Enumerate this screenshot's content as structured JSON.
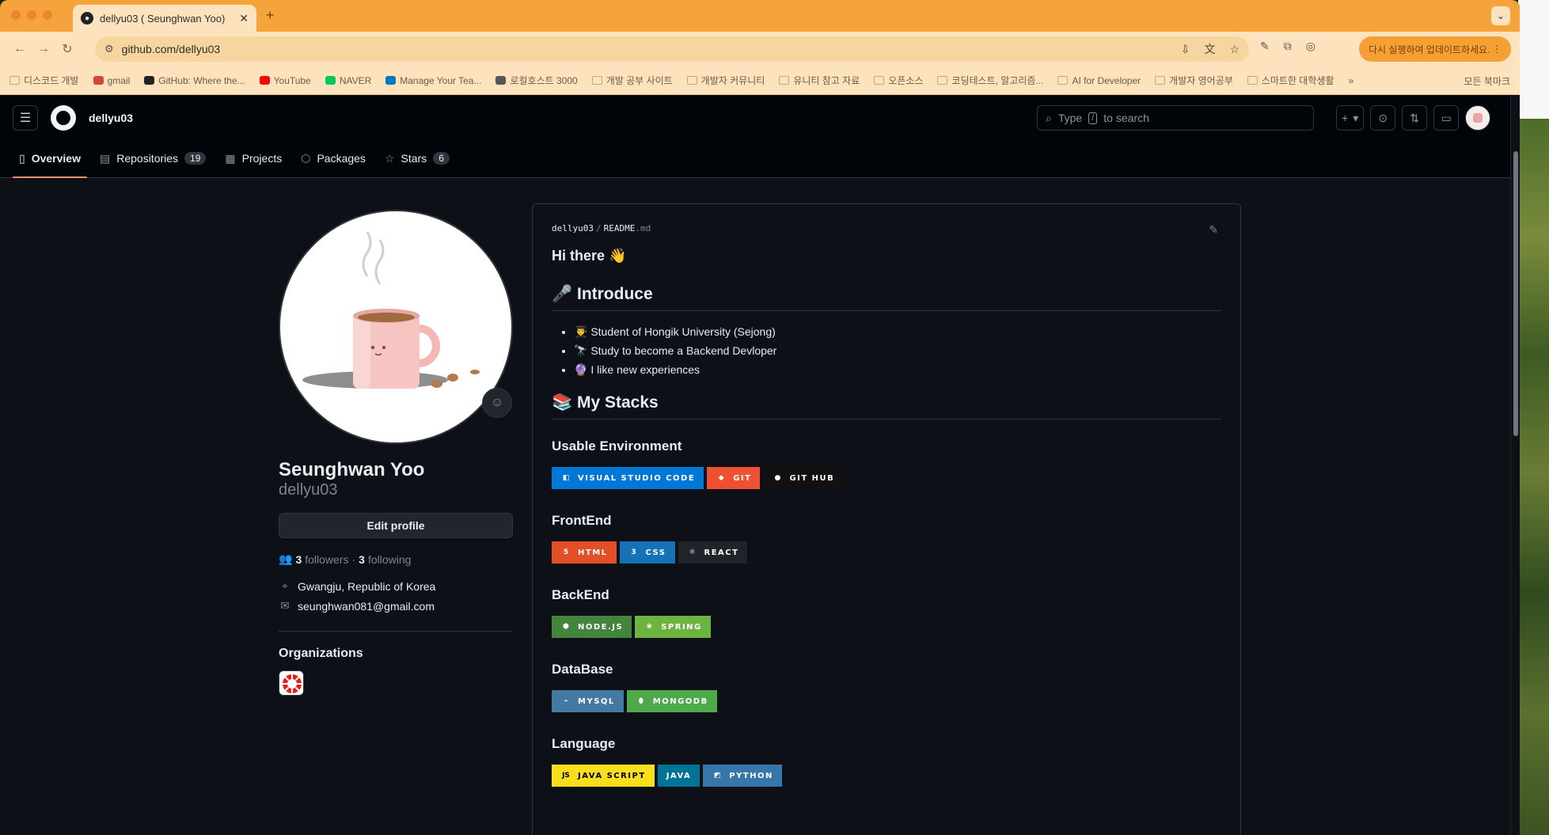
{
  "browser": {
    "tab_title": "dellyu03 ( Seunghwan Yoo)",
    "url": "github.com/dellyu03",
    "update_label": "다시 실행하여 업데이트하세요.",
    "bookmarks": [
      {
        "label": "디스코드 개발",
        "icon": "folder-icon",
        "color": ""
      },
      {
        "label": "gmail",
        "icon": "gmail-icon",
        "color": "#d44638"
      },
      {
        "label": "GitHub: Where the...",
        "icon": "github-icon",
        "color": "#222222"
      },
      {
        "label": "YouTube",
        "icon": "youtube-icon",
        "color": "#ff0000"
      },
      {
        "label": "NAVER",
        "icon": "naver-icon",
        "color": "#03c75a"
      },
      {
        "label": "Manage Your Tea...",
        "icon": "trello-icon",
        "color": "#0079bf"
      },
      {
        "label": "로컬호스트 3000",
        "icon": "globe-icon",
        "color": "#555555"
      },
      {
        "label": "개발 공부 사이트",
        "icon": "folder-icon",
        "color": ""
      },
      {
        "label": "개발자 커뮤니티",
        "icon": "folder-icon",
        "color": ""
      },
      {
        "label": "유니티 참고 자료",
        "icon": "folder-icon",
        "color": ""
      },
      {
        "label": "오픈소스",
        "icon": "folder-icon",
        "color": ""
      },
      {
        "label": "코딩테스트, 알고리즘...",
        "icon": "folder-icon",
        "color": ""
      },
      {
        "label": "AI for Developer",
        "icon": "folder-icon",
        "color": ""
      },
      {
        "label": "개발자 영어공부",
        "icon": "folder-icon",
        "color": ""
      },
      {
        "label": "스마트한 대학생활",
        "icon": "folder-icon",
        "color": ""
      }
    ],
    "more_bookmarks": "»",
    "all_bookmarks": "모든 북마크"
  },
  "header": {
    "username": "dellyu03",
    "search_prefix": "Type",
    "search_key": "/",
    "search_suffix": "to search"
  },
  "tabs": [
    {
      "label": "Overview",
      "icon": "book-icon",
      "count": ""
    },
    {
      "label": "Repositories",
      "icon": "repo-icon",
      "count": "19"
    },
    {
      "label": "Projects",
      "icon": "table-icon",
      "count": ""
    },
    {
      "label": "Packages",
      "icon": "package-icon",
      "count": ""
    },
    {
      "label": "Stars",
      "icon": "star-icon",
      "count": "6"
    }
  ],
  "profile": {
    "name": "Seunghwan Yoo",
    "login": "dellyu03",
    "edit_label": "Edit profile",
    "followers_count": "3",
    "followers_label": "followers",
    "dot": "·",
    "following_count": "3",
    "following_label": "following",
    "location": "Gwangju, Republic of Korea",
    "email": "seunghwan081@gmail.com",
    "organizations_title": "Organizations"
  },
  "readme": {
    "owner": "dellyu03",
    "sep": "/",
    "file": "README",
    "ext": ".md",
    "greeting": "Hi there 👋",
    "intro_title": "🎤 Introduce",
    "intro_items": [
      "👨‍🎓 Student of Hongik University (Sejong)",
      "🔭 Study to become a Backend Devloper",
      "🔮 I like new experiences"
    ],
    "stacks_title": "📚 My Stacks",
    "sections": {
      "env": {
        "title": "Usable Environment",
        "badges": [
          {
            "label": "VISUAL STUDIO CODE",
            "color": "#0078d7",
            "icon": "vscode-icon",
            "glyph": "◧"
          },
          {
            "label": "GIT",
            "color": "#f05032",
            "icon": "git-icon",
            "glyph": "◆"
          },
          {
            "label": "GIT HUB",
            "color": "#121011",
            "icon": "github-icon",
            "glyph": "●"
          }
        ]
      },
      "front": {
        "title": "FrontEnd",
        "badges": [
          {
            "label": "HTML",
            "color": "#e34f26",
            "icon": "html5-icon",
            "glyph": "5"
          },
          {
            "label": "CSS",
            "color": "#1572b6",
            "icon": "css3-icon",
            "glyph": "3"
          },
          {
            "label": "REACT",
            "color": "#20232a",
            "icon": "react-icon",
            "glyph": "⚛"
          }
        ]
      },
      "back": {
        "title": "BackEnd",
        "badges": [
          {
            "label": "NODE.JS",
            "color": "#43853d",
            "icon": "nodejs-icon",
            "glyph": "⬢"
          },
          {
            "label": "SPRING",
            "color": "#6db33f",
            "icon": "spring-icon",
            "glyph": "❀"
          }
        ]
      },
      "db": {
        "title": "DataBase",
        "badges": [
          {
            "label": "MYSQL",
            "color": "#4479a1",
            "icon": "mysql-icon",
            "glyph": "⌁"
          },
          {
            "label": "MONGODB",
            "color": "#4ea94b",
            "icon": "mongodb-icon",
            "glyph": "⬮"
          }
        ]
      },
      "lang": {
        "title": "Language",
        "badges": [
          {
            "label": "JAVA SCRIPT",
            "color": "#f7df1e",
            "text_color": "#000000",
            "icon": "javascript-icon",
            "glyph": "JS"
          },
          {
            "label": "JAVA",
            "color": "#007396",
            "icon": "java-icon",
            "glyph": ""
          },
          {
            "label": "PYTHON",
            "color": "#3776ab",
            "icon": "python-icon",
            "glyph": "◩"
          }
        ]
      }
    }
  },
  "colors": {
    "accent_tab": "#fd8c73",
    "page_bg": "#0d1117",
    "header_bg": "#010409",
    "chrome_frame": "#f6a33c"
  }
}
